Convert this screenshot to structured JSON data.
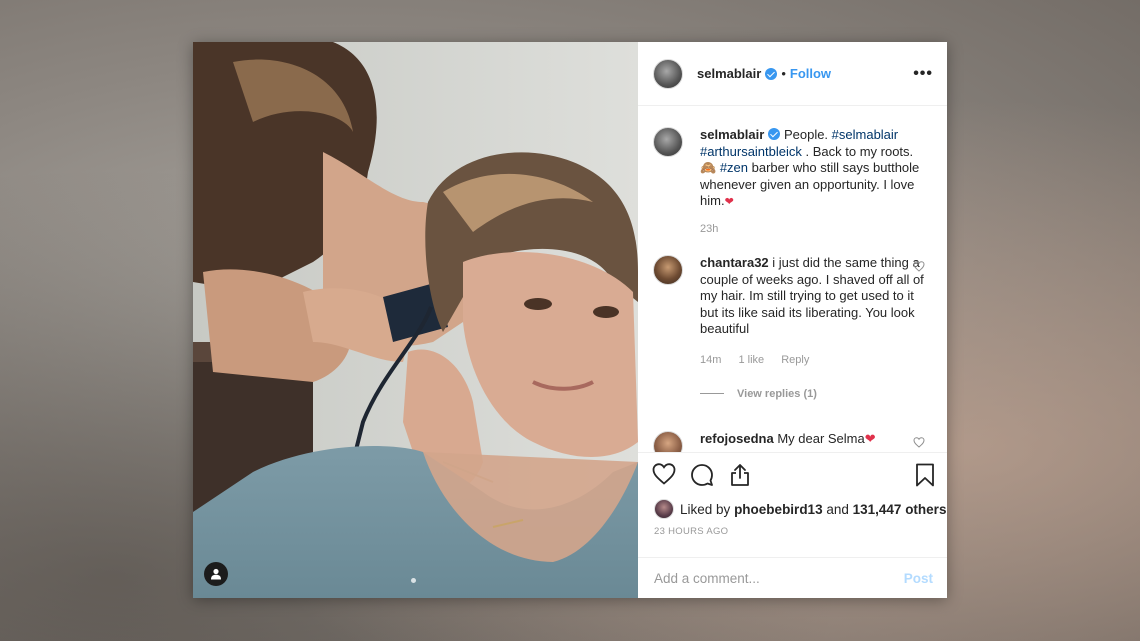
{
  "post": {
    "author": {
      "username": "selmablair",
      "verified": true,
      "follow_label": "Follow",
      "separator": "•",
      "more_label": "•••"
    },
    "caption": {
      "username": "selmablair",
      "text_1": "People. ",
      "tag_1": "#selmablair",
      "tag_2": "#arthursaintbleick",
      "text_2": " . Back to my roots. ",
      "emoji": "🙈",
      "tag_3": "#zen",
      "text_3": " barber who still says butthole whenever given an opportunity. I love him.",
      "heart": "❤",
      "time": "23h"
    },
    "comments": [
      {
        "username": "chantara32",
        "text": "i just did the same thing a couple of weeks ago. I shaved off all of my hair. Im still trying to get used to it but its like said its liberating. You look beautiful",
        "time": "14m",
        "likes": "1 like",
        "reply_label": "Reply",
        "view_replies": "View replies (1)"
      },
      {
        "username": "refojosedna",
        "text": "My dear Selma",
        "heart": "❤"
      }
    ],
    "liked_by": {
      "prefix": "Liked by ",
      "user": "phoebebird13",
      "middle": " and ",
      "others": "131,447 others"
    },
    "timestamp": "23 HOURS AGO",
    "add_comment_placeholder": "Add a comment...",
    "post_label": "Post"
  },
  "icons": {
    "like": "heart-icon",
    "comment": "comment-icon",
    "share": "share-icon",
    "save": "bookmark-icon",
    "tagged": "user-icon"
  },
  "colors": {
    "link": "#003569",
    "accent": "#3897f0",
    "verified": "#3897f0",
    "muted": "#999999",
    "post_disabled": "#b3dbff",
    "heart": "#e0314b"
  }
}
